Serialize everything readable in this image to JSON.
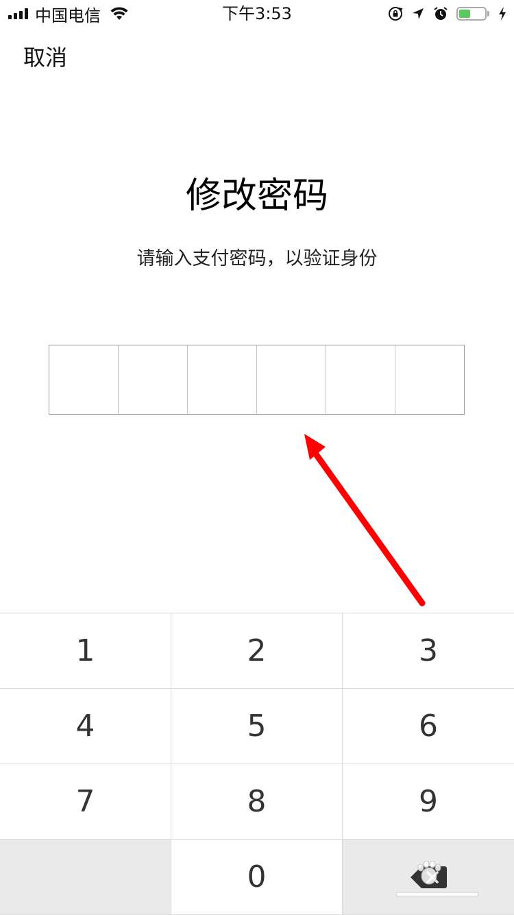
{
  "status_bar": {
    "carrier": "中国电信",
    "time": "下午3:53",
    "battery_level": 0.45,
    "icons": [
      "signal-icon",
      "wifi-icon",
      "orientation-lock-icon",
      "location-icon",
      "alarm-icon",
      "battery-icon",
      "charging-icon"
    ]
  },
  "nav": {
    "cancel_label": "取消"
  },
  "main": {
    "title": "修改密码",
    "subtitle": "请输入支付密码，以验证身份",
    "pin_length": 6
  },
  "keypad": {
    "keys": [
      "1",
      "2",
      "3",
      "4",
      "5",
      "6",
      "7",
      "8",
      "9",
      "",
      "0",
      "delete"
    ],
    "delete_icon": "backspace-icon"
  },
  "annotation": {
    "arrow_color": "#ff0000"
  },
  "watermark": {
    "name": "baidu-jingyan-watermark"
  },
  "colors": {
    "battery_fill": "#5ac85a",
    "keypad_gray": "#eaeaea",
    "border": "#dcdcdc"
  }
}
